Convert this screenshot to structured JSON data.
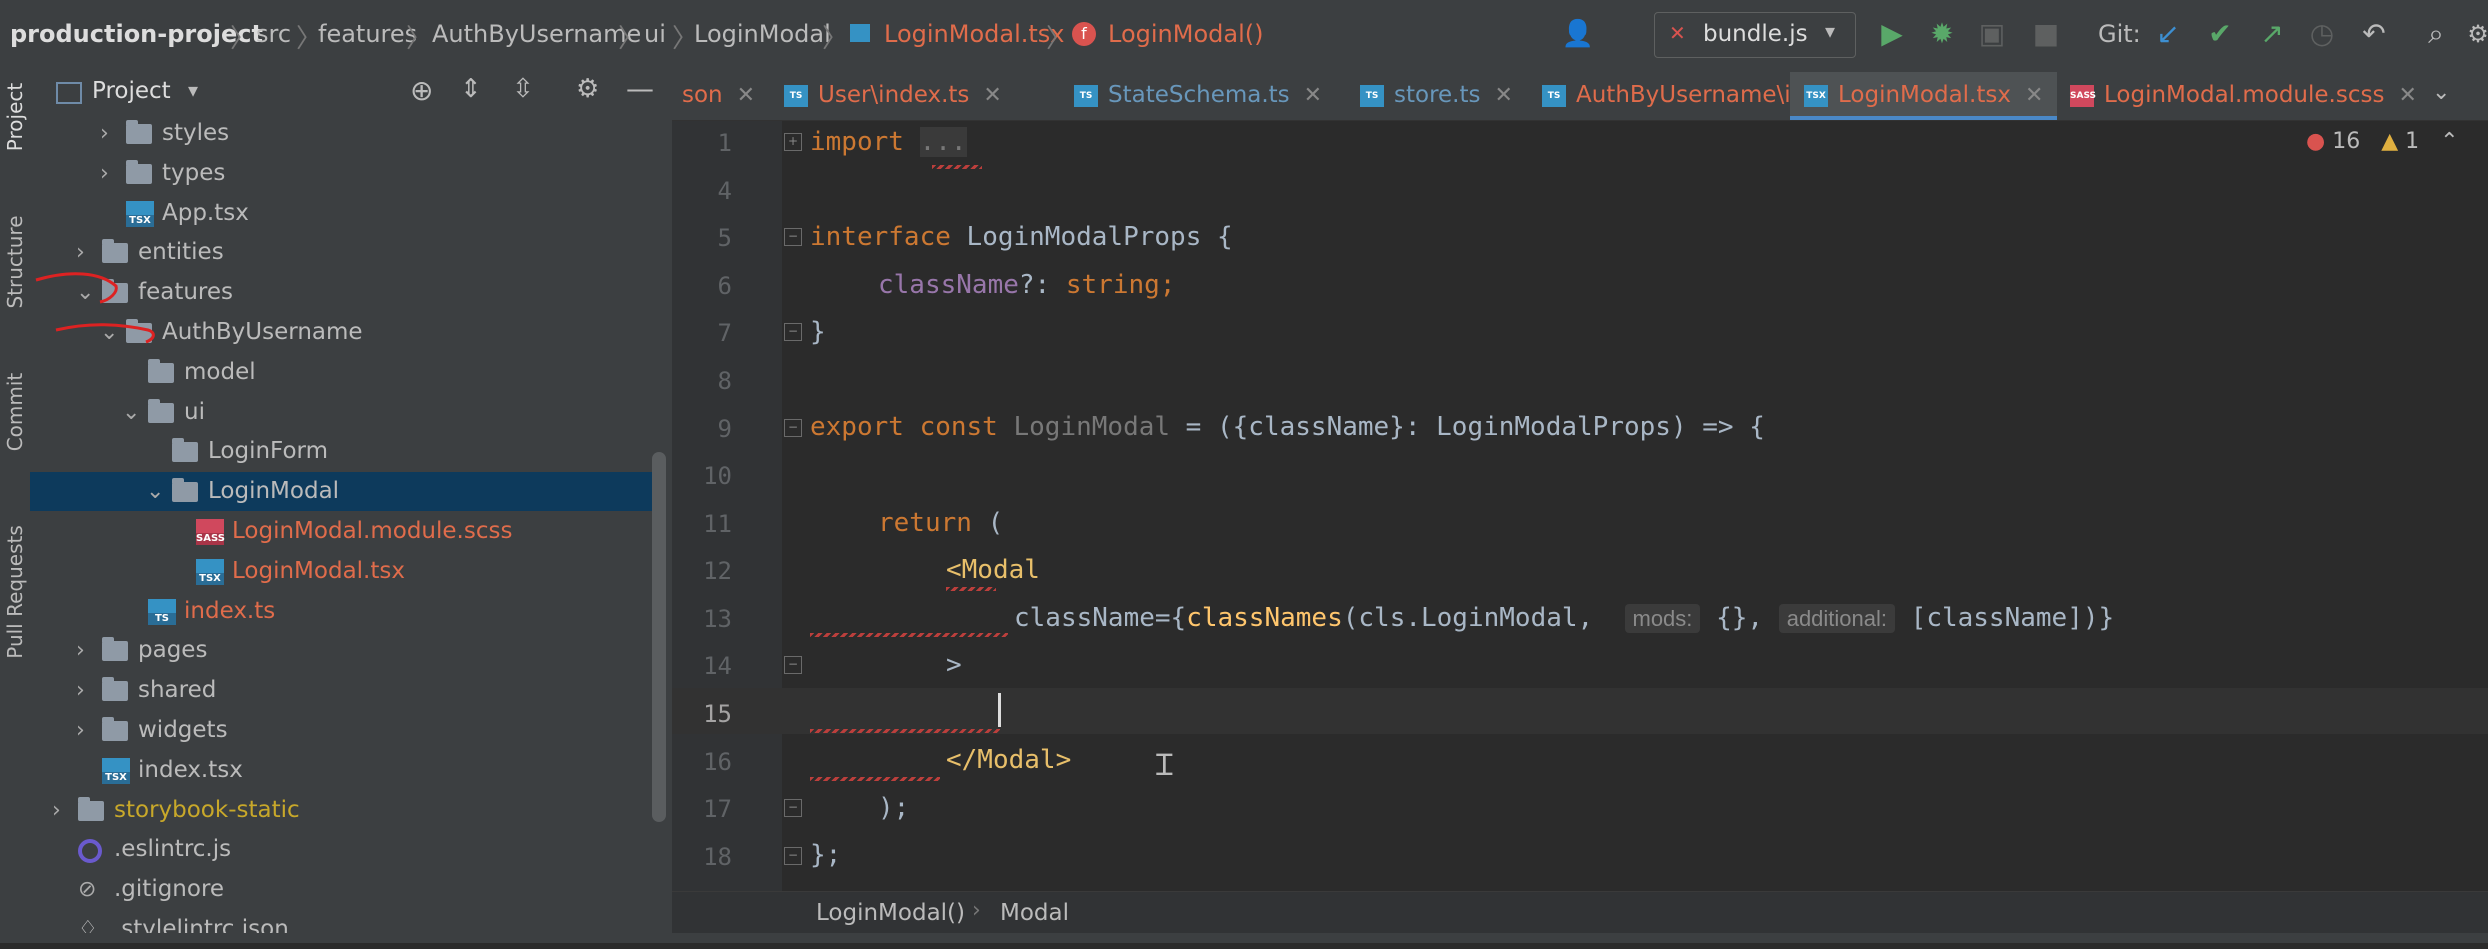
{
  "breadcrumbs": [
    "production-project",
    "src",
    "features",
    "AuthByUsername",
    "ui",
    "LoginModal",
    "LoginModal.tsx",
    "LoginModal()"
  ],
  "toolbar": {
    "run_config": "bundle.js",
    "git_label": "Git:"
  },
  "tool_stripe": [
    "Project",
    "Structure",
    "Commit",
    "Pull Requests"
  ],
  "project_panel": {
    "title": "Project",
    "tree": [
      {
        "label": "styles",
        "kind": "folder",
        "expanded": false
      },
      {
        "label": "types",
        "kind": "folder",
        "expanded": false
      },
      {
        "label": "App.tsx",
        "kind": "tsx"
      },
      {
        "label": "entities",
        "kind": "folder",
        "expanded": false
      },
      {
        "label": "features",
        "kind": "folder",
        "expanded": true
      },
      {
        "label": "AuthByUsername",
        "kind": "folder",
        "expanded": true
      },
      {
        "label": "model",
        "kind": "folder"
      },
      {
        "label": "ui",
        "kind": "folder",
        "expanded": true
      },
      {
        "label": "LoginForm",
        "kind": "folder"
      },
      {
        "label": "LoginModal",
        "kind": "folder",
        "expanded": true,
        "selected": true
      },
      {
        "label": "LoginModal.module.scss",
        "kind": "sass",
        "error": true
      },
      {
        "label": "LoginModal.tsx",
        "kind": "tsx",
        "error": true
      },
      {
        "label": "index.ts",
        "kind": "ts",
        "error": true
      },
      {
        "label": "pages",
        "kind": "folder",
        "expanded": false
      },
      {
        "label": "shared",
        "kind": "folder",
        "expanded": false
      },
      {
        "label": "widgets",
        "kind": "folder",
        "expanded": false
      },
      {
        "label": "index.tsx",
        "kind": "tsx"
      },
      {
        "label": "storybook-static",
        "kind": "folder",
        "expanded": false,
        "excluded": true
      },
      {
        "label": ".eslintrc.js",
        "kind": "eslint"
      },
      {
        "label": ".gitignore",
        "kind": "git"
      },
      {
        "label": ".stylelintrc.json",
        "kind": "stylelint"
      }
    ]
  },
  "tabs": [
    {
      "label": "son",
      "error": true
    },
    {
      "label": "User\\index.ts",
      "error": true
    },
    {
      "label": "StateSchema.ts",
      "error": false
    },
    {
      "label": "store.ts",
      "error": false
    },
    {
      "label": "AuthByUsername\\index.ts",
      "error": true
    },
    {
      "label": "LoginModal.tsx",
      "error": true,
      "active": true
    },
    {
      "label": "LoginModal.module.scss",
      "error": true
    }
  ],
  "inspections": {
    "errors": "16",
    "warnings": "1"
  },
  "editor": {
    "line_numbers": [
      "1",
      "4",
      "5",
      "6",
      "7",
      "8",
      "9",
      "10",
      "11",
      "12",
      "13",
      "14",
      "15",
      "16",
      "17",
      "18"
    ],
    "lines": {
      "l1_kw": "import",
      "l1_fold": "...",
      "l5_kw": "interface",
      "l5_name": " LoginModalProps {",
      "l6_prop": "className",
      "l6_rest": "?: ",
      "l6_type": "string;",
      "l7": "}",
      "l9_kw": "export const",
      "l9_name": " LoginModal",
      "l9_rest": " = ({className}: LoginModalProps) => {",
      "l11_kw": "return",
      "l11_rest": " (",
      "l12_tag": "<Modal",
      "l13_attr": "className={",
      "l13_fn": "classNames",
      "l13_rest": "(cls.LoginModal, ",
      "l13_hint1": "mods:",
      "l13_mid": " {}, ",
      "l13_hint2": "additional:",
      "l13_end": " [className])}",
      "l14": ">",
      "l16_tag": "</Modal>",
      "l17": ");",
      "l18": "};"
    }
  },
  "status_breadcrumbs": [
    "LoginModal()",
    "Modal"
  ]
}
